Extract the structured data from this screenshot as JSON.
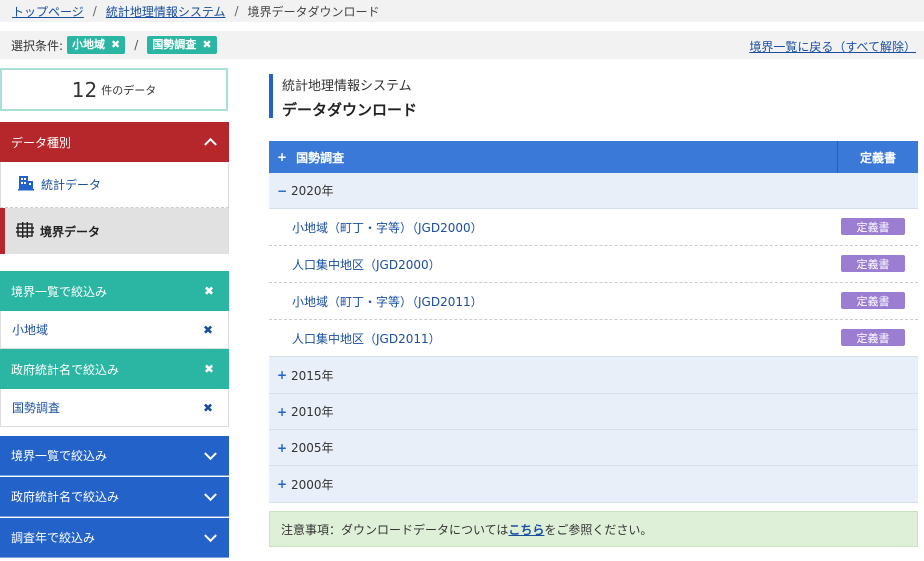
{
  "breadcrumb": {
    "home": "トップページ",
    "system": "統計地理情報システム",
    "current": "境界データダウンロード",
    "sep": "/"
  },
  "conditions": {
    "label": "選択条件:",
    "tags": [
      "小地域",
      "国勢調査"
    ],
    "slash": "/",
    "reset_link": "境界一覧に戻る（すべて解除）"
  },
  "sidebar": {
    "count": "12",
    "count_unit": "件のデータ",
    "data_type_header": "データ種別",
    "data_types": [
      "統計データ",
      "境界データ"
    ],
    "filter_boundary_header": "境界一覧で絞込み",
    "filter_boundary_value": "小地域",
    "filter_gov_header": "政府統計名で絞込み",
    "filter_gov_value": "国勢調査",
    "collapsed_filters": [
      "境界一覧で絞込み",
      "政府統計名で絞込み",
      "調査年で絞込み"
    ]
  },
  "main": {
    "system_name": "統計地理情報システム",
    "page_title": "データダウンロード",
    "table_header": "国勢調査",
    "table_def_header": "定義書",
    "years": [
      "2020年",
      "2015年",
      "2010年",
      "2005年",
      "2000年"
    ],
    "rows_2020": [
      {
        "name": "小地域（町丁・字等）（JGD2000）",
        "button": "定義書"
      },
      {
        "name": "人口集中地区（JGD2000）",
        "button": "定義書"
      },
      {
        "name": "小地域（町丁・字等）（JGD2011）",
        "button": "定義書"
      },
      {
        "name": "人口集中地区（JGD2011）",
        "button": "定義書"
      }
    ],
    "notice_prefix": "注意事項：ダウンロードデータについては",
    "notice_link": "こちら",
    "notice_suffix": "をご参照ください。",
    "expanded_sign": "−",
    "collapsed_sign": "+"
  },
  "colors": {
    "teal": "#2bb6a3",
    "red": "#b5272b",
    "blue": "#2362c9",
    "table_blue": "#3b79d8",
    "purple": "#9b7ed1",
    "notice_green": "#dff0d8"
  },
  "icons": {
    "table_plus": "plus-icon",
    "stat": "building-icon",
    "border": "grid-icon",
    "remove": "close-icon",
    "chevron_up": "chevron-up-icon",
    "chevron_down": "chevron-down-icon"
  }
}
